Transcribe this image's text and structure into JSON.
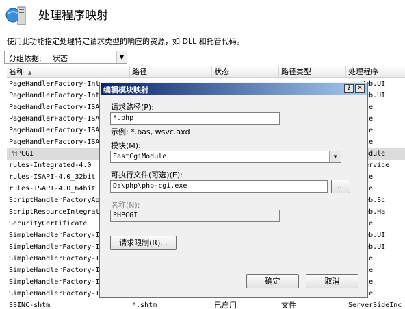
{
  "header": {
    "title": "处理程序映射",
    "description": "使用此功能指定处理特定请求类型的响应的资源，如 DLL 和托管代码。"
  },
  "group_by": {
    "label": "分组依据:",
    "value": "状态"
  },
  "grid": {
    "columns": [
      "名称",
      "路径",
      "状态",
      "路径类型",
      "处理程序"
    ],
    "rows": [
      {
        "name": "PageHandlerFactory-Int",
        "path": "",
        "state": "",
        "ptype": "",
        "handler": "em.Web.UI"
      },
      {
        "name": "PageHandlerFactory-Int",
        "path": "",
        "state": "",
        "ptype": "",
        "handler": "em.Web.UI"
      },
      {
        "name": "PageHandlerFactory-ISA",
        "path": "",
        "state": "",
        "ptype": "",
        "handler": "Module"
      },
      {
        "name": "PageHandlerFactory-ISA",
        "path": "",
        "state": "",
        "ptype": "",
        "handler": "Module"
      },
      {
        "name": "PageHandlerFactory-ISA",
        "path": "",
        "state": "",
        "ptype": "",
        "handler": "Module"
      },
      {
        "name": "PageHandlerFactory-ISA",
        "path": "",
        "state": "",
        "ptype": "",
        "handler": "Module"
      },
      {
        "name": "PHPCGI",
        "path": "",
        "state": "",
        "ptype": "",
        "handler": "CgiModule",
        "selected": true
      },
      {
        "name": "rules-Integrated-4.0",
        "path": "",
        "state": "",
        "ptype": "",
        "handler": "em.Service"
      },
      {
        "name": "rules-ISAPI-4.0_32bit",
        "path": "",
        "state": "",
        "ptype": "",
        "handler": "Module"
      },
      {
        "name": "rules-ISAPI-4.0_64bit",
        "path": "",
        "state": "",
        "ptype": "",
        "handler": "Module"
      },
      {
        "name": "ScriptHandlerFactoryAp",
        "path": "",
        "state": "",
        "ptype": "",
        "handler": "em.Web.Sc"
      },
      {
        "name": "ScriptResourceIntegrat",
        "path": "",
        "state": "",
        "ptype": "",
        "handler": "em.Web.Ha"
      },
      {
        "name": "SecurityCertificate",
        "path": "",
        "state": "",
        "ptype": "",
        "handler": "Module"
      },
      {
        "name": "SimpleHandlerFactory-I",
        "path": "",
        "state": "",
        "ptype": "",
        "handler": "em.Web.UI"
      },
      {
        "name": "SimpleHandlerFactory-I",
        "path": "",
        "state": "",
        "ptype": "",
        "handler": "em.Web.UI"
      },
      {
        "name": "SimpleHandlerFactory-I",
        "path": "",
        "state": "",
        "ptype": "",
        "handler": "Module"
      },
      {
        "name": "SimpleHandlerFactory-I",
        "path": "",
        "state": "",
        "ptype": "",
        "handler": "Module"
      },
      {
        "name": "SimpleHandlerFactory-I",
        "path": "",
        "state": "",
        "ptype": "",
        "handler": "Module"
      },
      {
        "name": "SimpleHandlerFactory-I",
        "path": "",
        "state": "",
        "ptype": "",
        "handler": "Module"
      },
      {
        "name": "SSINC-shtm",
        "path": "*.shtm",
        "state": "已启用",
        "ptype": "文件",
        "handler": "ServerSideInc"
      }
    ]
  },
  "dialog": {
    "title": "编辑模块映射",
    "help_label": "?",
    "close_label": "✕",
    "request_path_label": "请求路径(P):",
    "request_path_value": "*.php",
    "example_text": "示例: *.bas, wsvc.axd",
    "module_label": "模块(M):",
    "module_value": "FastCgiModule",
    "executable_label": "可执行文件(可选)(E):",
    "executable_value": "D:\\php\\php-cgi.exe",
    "browse_label": "...",
    "name_label": "名称(N):",
    "name_value": "PHPCGI",
    "restrictions_label": "请求限制(R)...",
    "ok_label": "确定",
    "cancel_label": "取消"
  },
  "colors": {
    "title_start": "#0a246a",
    "title_end": "#a6caf0",
    "selected_row": "#dcdcdc"
  }
}
